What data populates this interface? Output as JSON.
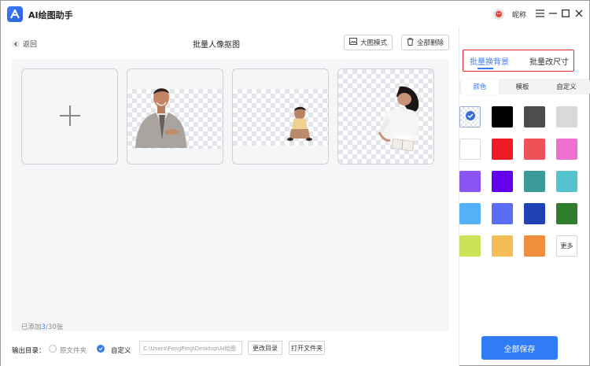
{
  "app": {
    "title": "AI绘图助手",
    "user_name": "昵称"
  },
  "icons": {
    "logo": "app-logo-icon",
    "avatar": "user-avatar-icon",
    "menu": "menu-icon",
    "minimize": "minimize-icon",
    "maximize": "maximize-icon",
    "close": "close-icon"
  },
  "toolbar": {
    "back_label": "返回",
    "page_title": "批量人像抠图",
    "large_mode_label": "大图模式",
    "delete_all_label": "全部删除"
  },
  "workspace": {
    "add_icon": "plus-icon",
    "images": [
      {
        "name": "man-in-suit-cutout"
      },
      {
        "name": "child-crouching-cutout"
      },
      {
        "name": "woman-reading-cutout"
      }
    ],
    "added_prefix": "已添加",
    "added_count": "3",
    "added_suffix": "/30张"
  },
  "output": {
    "label": "输出目录：",
    "option_original": "原文件夹",
    "option_custom": "自定义",
    "selected": "自定义",
    "path": "C:\\Users\\FengPing\\Desktop\\AI绘图",
    "change_dir_label": "更改目录",
    "open_folder_label": "打开文件夹"
  },
  "right": {
    "tabs": [
      {
        "label": "批量换背景",
        "active": true
      },
      {
        "label": "批量改尺寸",
        "active": false
      }
    ],
    "segments": [
      {
        "label": "颜色",
        "active": true
      },
      {
        "label": "模板",
        "active": false
      },
      {
        "label": "自定义",
        "active": false
      }
    ],
    "selected_swatch": "transparent",
    "colors": [
      "transparent",
      "#000000",
      "#4d4d4d",
      "#d9d9d9",
      "#ffffff",
      "#ee1a24",
      "#ee5257",
      "#ee6fcd",
      "#8b55f3",
      "#6300ee",
      "#3a9a97",
      "#52c3cf",
      "#55b1f7",
      "#5a6ef5",
      "#1f43b3",
      "#2f7d2d",
      "#cde259",
      "#f4bd55",
      "#f08e3d"
    ],
    "more_label": "更多",
    "save_all_label": "全部保存"
  },
  "colors": {
    "accent": "#2f7cf6",
    "highlight_box": "#e0242c"
  }
}
